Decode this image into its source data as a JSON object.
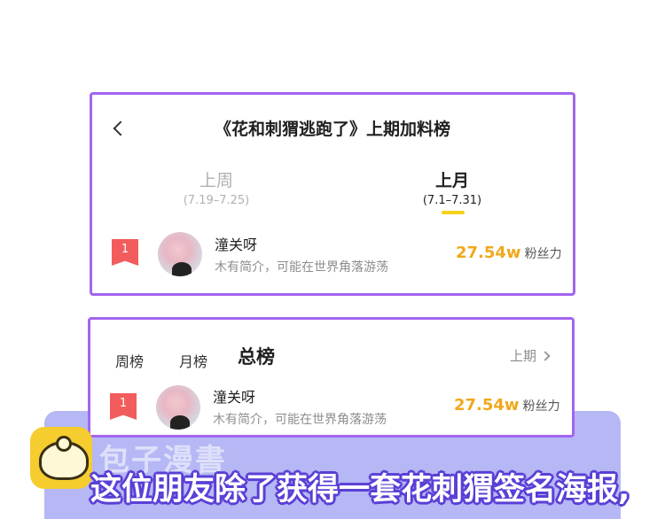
{
  "header": {
    "back_icon": "chevron-left-icon",
    "title": "《花和刺猬逃跑了》上期加料榜"
  },
  "periods": {
    "week": {
      "label": "上周",
      "range": "(7.19–7.25)"
    },
    "month": {
      "label": "上月",
      "range": "(7.1–7.31)",
      "selected": true
    }
  },
  "entry1": {
    "rank": "1",
    "name": "潼关呀",
    "desc": "木有简介，可能在世界角落游荡",
    "power_value": "27.54w",
    "power_label": "粉丝力"
  },
  "tabs": {
    "week": "周榜",
    "month": "月榜",
    "total": "总榜",
    "prev": "上期"
  },
  "entry2": {
    "rank": "1",
    "name": "潼关呀",
    "desc": "木有简介，可能在世界角落游荡",
    "power_value": "27.54w",
    "power_label": "粉丝力"
  },
  "overlay": {
    "watermark": "包子漫書",
    "caption": "这位朋友除了获得一套花刺猬签名海报,"
  },
  "colors": {
    "border": "#a365f0",
    "accent_yellow": "#f7d117",
    "power": "#f0a81c",
    "rank_badge": "#f25c5c",
    "panel": "#b5b8f4"
  }
}
